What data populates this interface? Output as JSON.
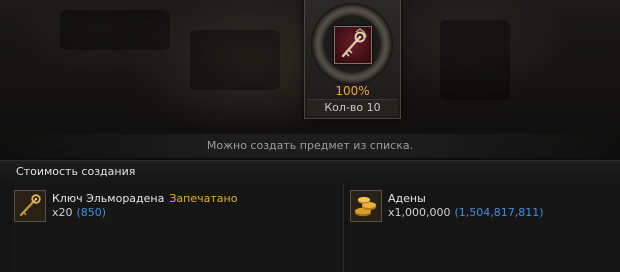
{
  "product": {
    "icon": "elmoreden-key-icon",
    "success_rate": "100%",
    "quantity_label": "Кол-во 10"
  },
  "message": "Можно создать предмет из списка.",
  "cost_section": {
    "title": "Стоимость создания",
    "items": [
      {
        "icon": "key-icon",
        "name": "Ключ Эльморадена",
        "tag": "Запечатано",
        "required": "x20",
        "owned": "(850)"
      },
      {
        "icon": "adena-coins-icon",
        "name": "Адены",
        "tag": "",
        "required": "x1,000,000",
        "owned": "(1,504,817,811)"
      }
    ]
  },
  "colors": {
    "accent_orange": "#f0a431",
    "sealed_yellow": "#e3b02e",
    "owned_blue": "#3f8fe0"
  }
}
